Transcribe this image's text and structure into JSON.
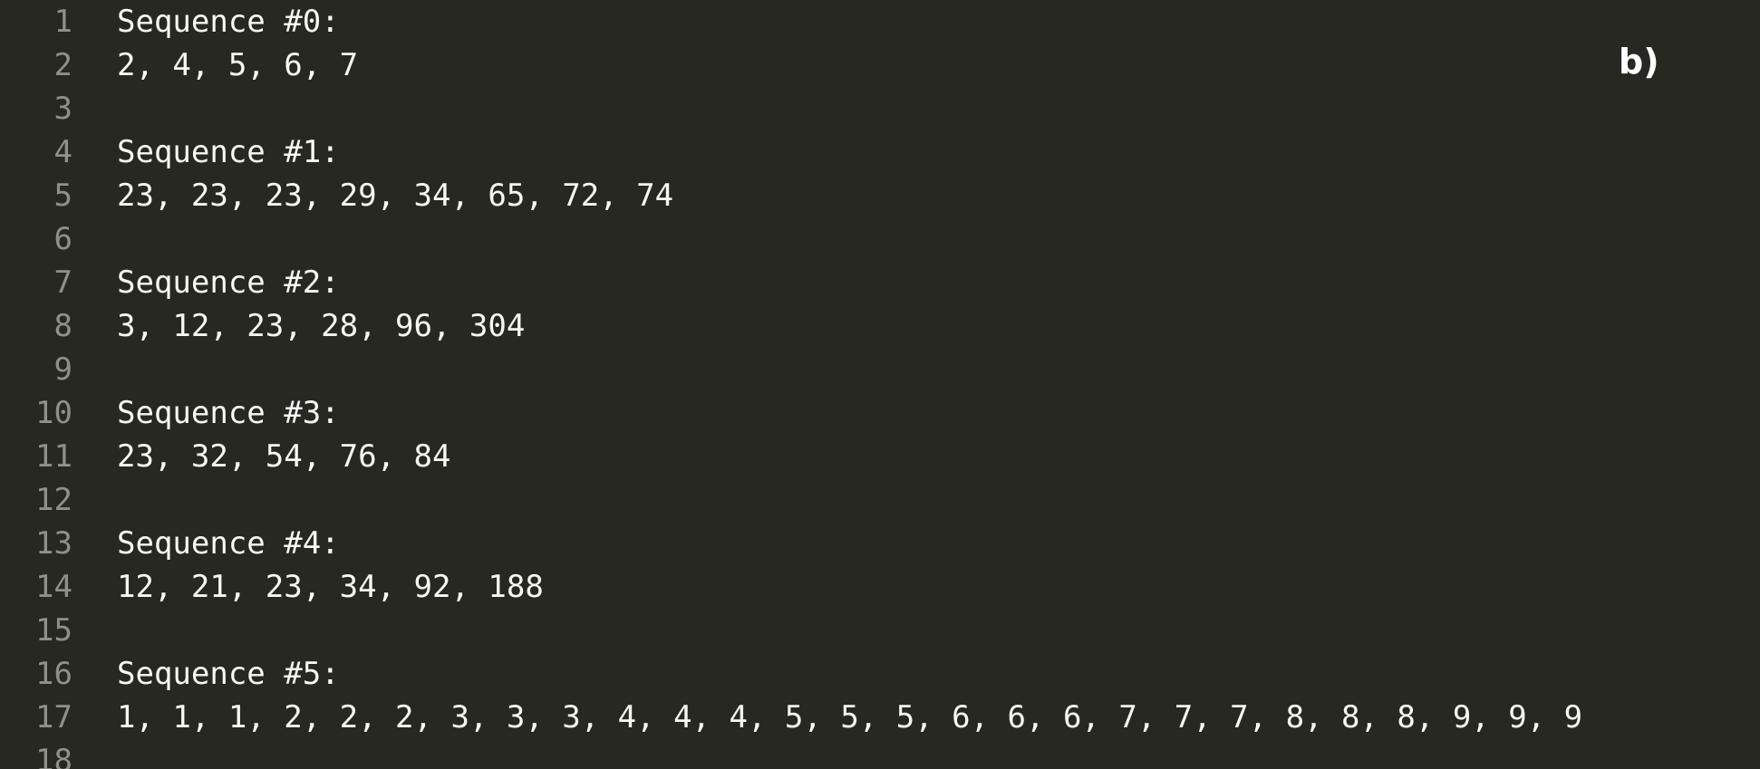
{
  "panel_label": "b)",
  "lines": [
    {
      "number": "1",
      "text": "Sequence #0:"
    },
    {
      "number": "2",
      "text": "2, 4, 5, 6, 7"
    },
    {
      "number": "3",
      "text": ""
    },
    {
      "number": "4",
      "text": "Sequence #1:"
    },
    {
      "number": "5",
      "text": "23, 23, 23, 29, 34, 65, 72, 74"
    },
    {
      "number": "6",
      "text": ""
    },
    {
      "number": "7",
      "text": "Sequence #2:"
    },
    {
      "number": "8",
      "text": "3, 12, 23, 28, 96, 304"
    },
    {
      "number": "9",
      "text": ""
    },
    {
      "number": "10",
      "text": "Sequence #3:"
    },
    {
      "number": "11",
      "text": "23, 32, 54, 76, 84"
    },
    {
      "number": "12",
      "text": ""
    },
    {
      "number": "13",
      "text": "Sequence #4:"
    },
    {
      "number": "14",
      "text": "12, 21, 23, 34, 92, 188"
    },
    {
      "number": "15",
      "text": ""
    },
    {
      "number": "16",
      "text": "Sequence #5:"
    },
    {
      "number": "17",
      "text": "1, 1, 1, 2, 2, 2, 3, 3, 3, 4, 4, 4, 5, 5, 5, 6, 6, 6, 7, 7, 7, 8, 8, 8, 9, 9, 9"
    },
    {
      "number": "18",
      "text": ""
    }
  ]
}
